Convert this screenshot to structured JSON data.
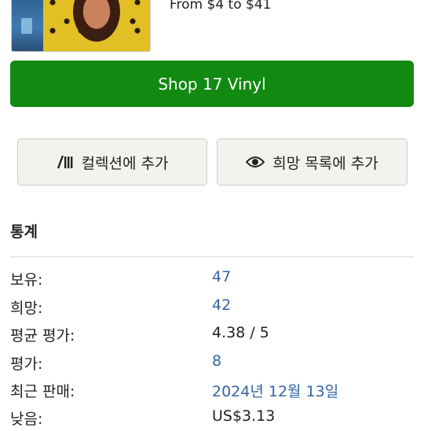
{
  "product": {
    "price_range": "From $4 to $41",
    "shop_label": "Shop 17 Vinyl"
  },
  "actions": {
    "collection_label": "컬렉션에 추가",
    "collection_icon": "vinyl-records-icon",
    "wantlist_label": "희망 목록에 추가",
    "wantlist_icon": "eye-icon"
  },
  "stats": {
    "title": "통계",
    "rows": [
      {
        "label": "보유:",
        "value": "47",
        "link": true
      },
      {
        "label": "희망:",
        "value": "42",
        "link": true
      },
      {
        "label": "평균 평가:",
        "value": "4.38 / 5",
        "link": false
      },
      {
        "label": "평가:",
        "value": "8",
        "link": true
      },
      {
        "label": "최근 판매:",
        "value": "2024년 12월 13일",
        "link": true
      },
      {
        "label": "낮음:",
        "value": "US$3.13",
        "link": false
      }
    ]
  },
  "colors": {
    "shop_button": "#128a12",
    "link": "#3465a4"
  }
}
